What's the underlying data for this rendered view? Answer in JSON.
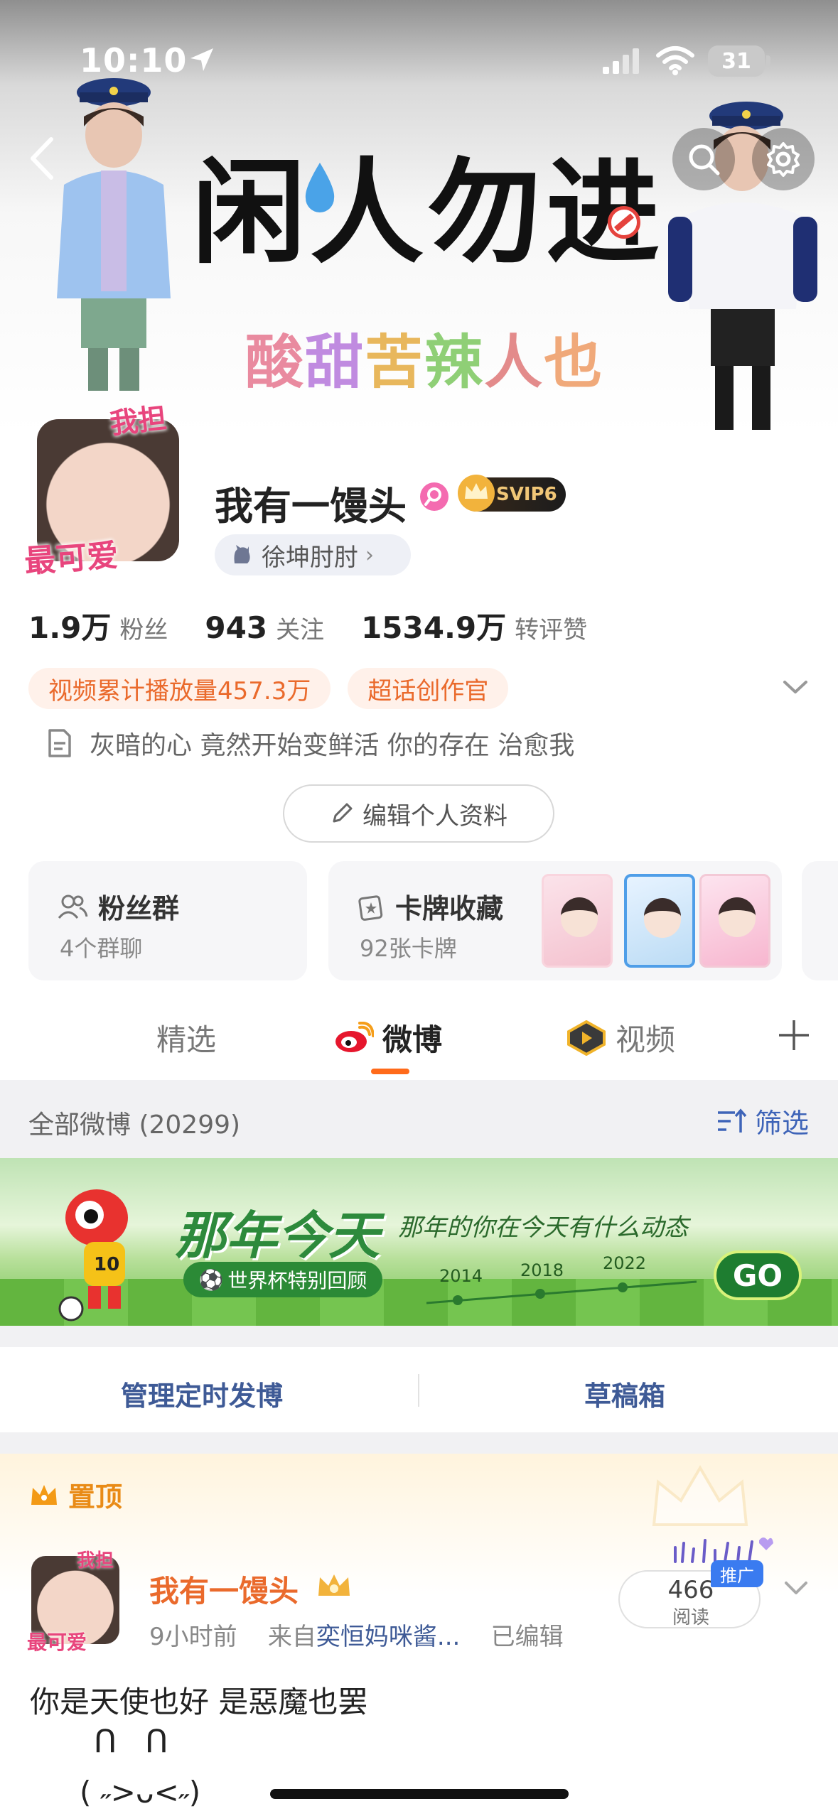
{
  "status_bar": {
    "time": "10:10",
    "battery": "31"
  },
  "banner": {
    "title": "闲人勿进",
    "subtitle_chars": [
      "酸",
      "甜",
      "苦",
      "辣",
      "人",
      "也"
    ]
  },
  "profile": {
    "avatar_sticker_top": "我担",
    "avatar_sticker_bottom": "最可爱",
    "name": "我有一馒头",
    "vip_label": "SVIP6",
    "supertopic": "徐坤肘肘",
    "stats": [
      {
        "num": "1.9万",
        "label": "粉丝"
      },
      {
        "num": "943",
        "label": "关注"
      },
      {
        "num": "1534.9万",
        "label": "转评赞"
      }
    ],
    "tags": [
      "视频累计播放量457.3万",
      "超话创作官"
    ],
    "bio": "灰暗的心 竟然开始变鲜活 你的存在 治愈我",
    "edit_label": "编辑个人资料"
  },
  "cards": {
    "fans": {
      "title": "粉丝群",
      "sub": "4个群聊"
    },
    "collect": {
      "title": "卡牌收藏",
      "sub": "92张卡牌"
    }
  },
  "tabs": {
    "featured": "精选",
    "weibo": "微博",
    "video": "视频",
    "active": "weibo"
  },
  "feed": {
    "count": "全部微博 (20299)",
    "filter": "筛选"
  },
  "promo": {
    "title": "那年今天",
    "subtitle": "那年的你在今天有什么动态",
    "chip": "世界杯特别回顾",
    "years": [
      "2014",
      "2018",
      "2022"
    ],
    "go": "GO"
  },
  "manage": {
    "scheduled": "管理定时发博",
    "drafts": "草稿箱"
  },
  "pinned_post": {
    "pin_label": "置顶",
    "author": "我有一馒头",
    "time": "9小时前",
    "source_prefix": "来自",
    "source": "奕恒妈咪酱...",
    "edited": "已编辑",
    "reads": "466",
    "reads_label": "阅读",
    "promo_tag": "推广",
    "text": "你是天使也好 是惡魔也罢",
    "kaomoji_top": "ᑎᑎ",
    "kaomoji_bottom": "( ˶>ᴗ<˶)"
  },
  "colors": {
    "accent": "#ff6a1a",
    "link": "#3e5a96",
    "svip_gold": "#f1c777"
  }
}
